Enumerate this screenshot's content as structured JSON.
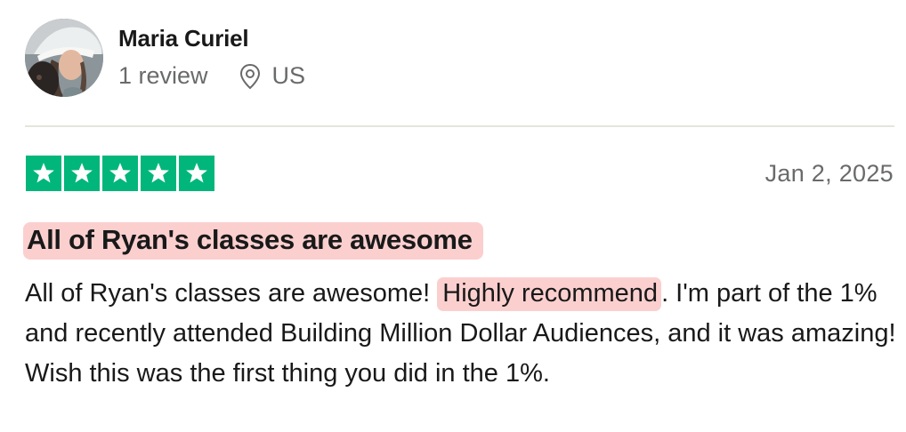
{
  "reviewer": {
    "name": "Maria Curiel",
    "reviews_count": "1 review",
    "location": "US",
    "avatar_icon": "reviewer-avatar-photo",
    "location_icon": "map-pin-icon"
  },
  "review": {
    "rating": 5,
    "rating_max": 5,
    "star_color": "#00b67a",
    "highlight_color": "#fccfcf",
    "date": "Jan 2, 2025",
    "title": "All of Ryan's classes are awesome",
    "body_part1": "All of Ryan's classes are awesome!",
    "body_highlight": "Highly recommend",
    "body_part2": ". I'm part of the 1% and recently attended Building Million Dollar Audiences, and it was amazing! Wish this was the first thing you did in the 1%."
  }
}
